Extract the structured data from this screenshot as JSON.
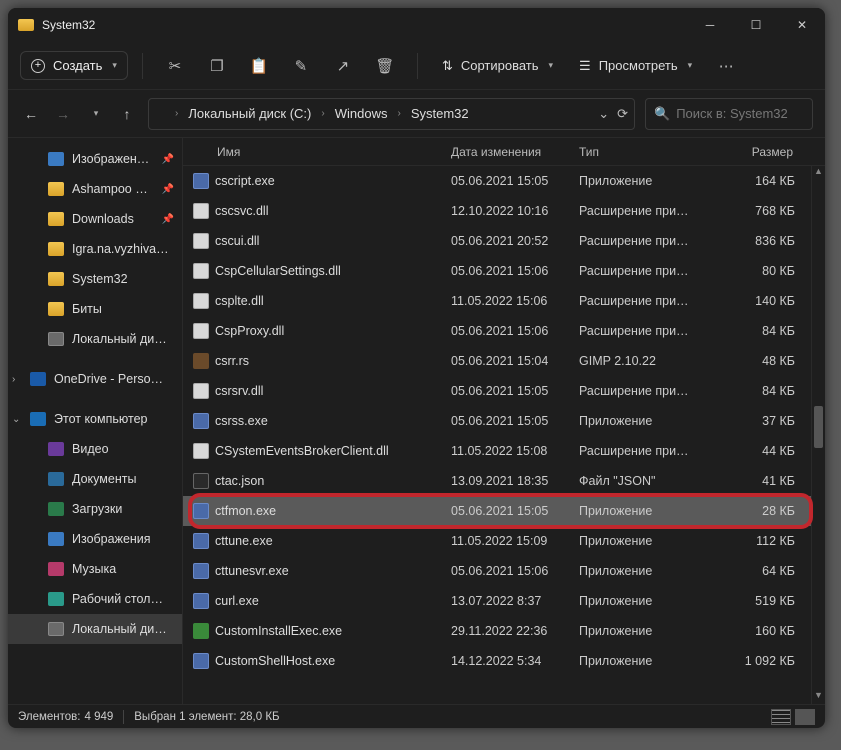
{
  "title": "System32",
  "toolbar": {
    "create": "Создать",
    "sort": "Сортировать",
    "view": "Просмотреть"
  },
  "breadcrumb": [
    "Локальный диск (C:)",
    "Windows",
    "System32"
  ],
  "search_placeholder": "Поиск в: System32",
  "columns": {
    "name": "Имя",
    "date": "Дата изменения",
    "type": "Тип",
    "size": "Размер"
  },
  "sidebar": {
    "quick": [
      {
        "label": "Изображен…",
        "ico": "blue",
        "pin": true
      },
      {
        "label": "Ashampoo …",
        "ico": "folder",
        "pin": true
      },
      {
        "label": "Downloads",
        "ico": "folder",
        "pin": true
      },
      {
        "label": "Igra.na.vyzhiva…",
        "ico": "folder"
      },
      {
        "label": "System32",
        "ico": "folder"
      },
      {
        "label": "Биты",
        "ico": "folder"
      },
      {
        "label": "Локальный ди…",
        "ico": "drive"
      }
    ],
    "onedrive": "OneDrive - Perso…",
    "thispc": "Этот компьютер",
    "pc": [
      {
        "label": "Видео",
        "ico": "vid"
      },
      {
        "label": "Документы",
        "ico": "doc"
      },
      {
        "label": "Загрузки",
        "ico": "dl"
      },
      {
        "label": "Изображения",
        "ico": "blue"
      },
      {
        "label": "Музыка",
        "ico": "mus"
      },
      {
        "label": "Рабочий стол…",
        "ico": "teal"
      },
      {
        "label": "Локальный ди…",
        "ico": "drive",
        "sel": true
      }
    ]
  },
  "files": [
    {
      "name": "cscript.exe",
      "date": "05.06.2021 15:05",
      "type": "Приложение",
      "size": "164 КБ",
      "ico": "exe"
    },
    {
      "name": "cscsvc.dll",
      "date": "12.10.2022 10:16",
      "type": "Расширение при…",
      "size": "768 КБ",
      "ico": "dll"
    },
    {
      "name": "cscui.dll",
      "date": "05.06.2021 20:52",
      "type": "Расширение при…",
      "size": "836 КБ",
      "ico": "dll"
    },
    {
      "name": "CspCellularSettings.dll",
      "date": "05.06.2021 15:06",
      "type": "Расширение при…",
      "size": "80 КБ",
      "ico": "dll"
    },
    {
      "name": "csplte.dll",
      "date": "11.05.2022 15:06",
      "type": "Расширение при…",
      "size": "140 КБ",
      "ico": "dll"
    },
    {
      "name": "CspProxy.dll",
      "date": "05.06.2021 15:06",
      "type": "Расширение при…",
      "size": "84 КБ",
      "ico": "dll"
    },
    {
      "name": "csrr.rs",
      "date": "05.06.2021 15:04",
      "type": "GIMP 2.10.22",
      "size": "48 КБ",
      "ico": "gimp"
    },
    {
      "name": "csrsrv.dll",
      "date": "05.06.2021 15:05",
      "type": "Расширение при…",
      "size": "84 КБ",
      "ico": "dll"
    },
    {
      "name": "csrss.exe",
      "date": "05.06.2021 15:05",
      "type": "Приложение",
      "size": "37 КБ",
      "ico": "exe"
    },
    {
      "name": "CSystemEventsBrokerClient.dll",
      "date": "11.05.2022 15:08",
      "type": "Расширение при…",
      "size": "44 КБ",
      "ico": "dll"
    },
    {
      "name": "ctac.json",
      "date": "13.09.2021 18:35",
      "type": "Файл \"JSON\"",
      "size": "41 КБ",
      "ico": "json"
    },
    {
      "name": "ctfmon.exe",
      "date": "05.06.2021 15:05",
      "type": "Приложение",
      "size": "28 КБ",
      "ico": "exe",
      "sel": true
    },
    {
      "name": "cttune.exe",
      "date": "11.05.2022 15:09",
      "type": "Приложение",
      "size": "112 КБ",
      "ico": "exe"
    },
    {
      "name": "cttunesvr.exe",
      "date": "05.06.2021 15:06",
      "type": "Приложение",
      "size": "64 КБ",
      "ico": "exe"
    },
    {
      "name": "curl.exe",
      "date": "13.07.2022 8:37",
      "type": "Приложение",
      "size": "519 КБ",
      "ico": "exe"
    },
    {
      "name": "CustomInstallExec.exe",
      "date": "29.11.2022 22:36",
      "type": "Приложение",
      "size": "160 КБ",
      "ico": "inst"
    },
    {
      "name": "CustomShellHost.exe",
      "date": "14.12.2022 5:34",
      "type": "Приложение",
      "size": "1 092 КБ",
      "ico": "exe"
    }
  ],
  "status": {
    "elements_lbl": "Элементов:",
    "elements_val": "4 949",
    "sel_lbl": "Выбран 1 элемент: 28,0 КБ"
  }
}
